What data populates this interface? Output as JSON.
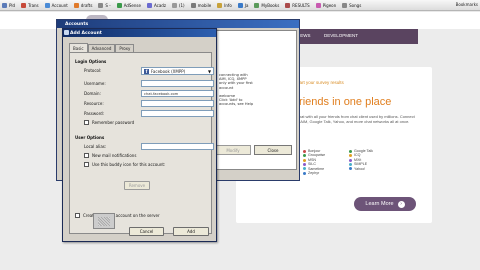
{
  "bookmarks": [
    {
      "label": "Pld",
      "color": "#5a7ab8"
    },
    {
      "label": "Trans",
      "color": "#c74a3a"
    },
    {
      "label": "Account",
      "color": "#4a8bd6"
    },
    {
      "label": "drafts",
      "color": "#e07a2a"
    },
    {
      "label": "S -",
      "color": "#888888"
    },
    {
      "label": "AdSense",
      "color": "#3a9a4a"
    },
    {
      "label": "Acadz",
      "color": "#6a6ad0"
    },
    {
      "label": "(1)",
      "color": "#999999"
    },
    {
      "label": "mobile",
      "color": "#7a7a7a"
    },
    {
      "label": "Info",
      "color": "#c8a23a"
    },
    {
      "label": "Ja",
      "color": "#3a7ac8"
    },
    {
      "label": "MyBooks",
      "color": "#5a9a5a"
    },
    {
      "label": "RESULTS",
      "color": "#aa4a4a"
    },
    {
      "label": "Pigeon",
      "color": "#c85ab0"
    },
    {
      "label": "Songs",
      "color": "#888888"
    }
  ],
  "bookmarks_right": "Bookmarks",
  "site": {
    "nav_items": [
      "VIEWS",
      "DEVELOPMENT"
    ],
    "promo": "start your survey results",
    "headline": "friends in one place",
    "description": "Chat with all your friends from chat client used by millions. Connect to AIM, Google Talk, Yahoo, and more chat networks all at once.",
    "protocols_col1": [
      "Bonjour",
      "Groupwise",
      "MSN",
      "SILC",
      "Sametime",
      "Zephyr"
    ],
    "protocols_col2": [
      "Google Talk",
      "ICQ",
      "MXit",
      "SIMPLE",
      "Yahoo!"
    ],
    "protocols_col0": [
      "AIM",
      "Gadu-Gadu",
      "IRC",
      "MySpaceIM",
      "QQ",
      "XMPP"
    ],
    "learn_more": "Learn More",
    "learn_more_arrow": "›"
  },
  "accounts_window": {
    "title": "Accounts",
    "text_lines": [
      "connecting with",
      "AIM, ICQ, XMPP",
      "only with your first",
      "account",
      "",
      "welcome",
      "Click 'Add' to",
      "accounts, see Help"
    ],
    "modify_label": "Modify",
    "close_label": "Close"
  },
  "dialog": {
    "title": "Add Account",
    "tabs": [
      "Basic",
      "Advanced",
      "Proxy"
    ],
    "login_options_heading": "Login Options",
    "protocol_label": "Protocol:",
    "protocol_value": "Facebook (XMPP)",
    "protocol_icon": "f",
    "dropdown_arrow": "▼",
    "username_label": "Username:",
    "username_value": "",
    "domain_label": "Domain:",
    "domain_value": "chat.facebook.com",
    "resource_label": "Resource:",
    "resource_value": "",
    "password_label": "Password:",
    "password_value": "",
    "remember_password": "Remember password",
    "user_options_heading": "User Options",
    "local_alias_label": "Local alias:",
    "local_alias_value": "",
    "new_mail_label": "New mail notifications",
    "buddy_icon_label": "Use this buddy icon for this account:",
    "remove_label": "Remove",
    "create_account_label": "Create this new account on the server",
    "cancel_label": "Cancel",
    "add_label": "Add"
  },
  "colors": {
    "nav_bg": "#5a4460",
    "accent_orange": "#e07e1e",
    "learn_more_bg": "#6d5478",
    "title_bar": "#102c66"
  }
}
